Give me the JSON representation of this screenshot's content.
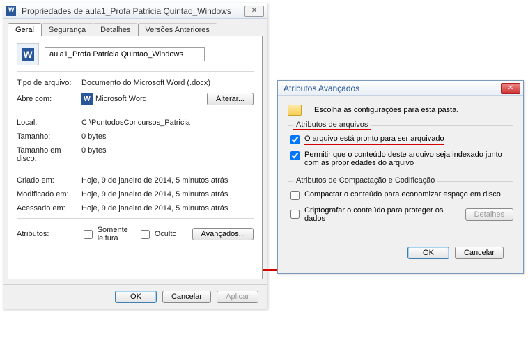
{
  "props_window": {
    "title": "Propriedades de aula1_Profa Patrícia Quintao_Windows",
    "close_glyph": "✕",
    "tabs": {
      "geral": "Geral",
      "seguranca": "Segurança",
      "detalhes": "Detalhes",
      "versoes": "Versões Anteriores"
    },
    "file_name": "aula1_Profa Patrícia Quintao_Windows",
    "labels": {
      "tipo": "Tipo de arquivo:",
      "abre": "Abre com:",
      "local": "Local:",
      "tamanho": "Tamanho:",
      "tamanho_disco": "Tamanho em disco:",
      "criado": "Criado em:",
      "modificado": "Modificado em:",
      "acessado": "Acessado em:",
      "atributos": "Atributos:"
    },
    "values": {
      "tipo": "Documento do Microsoft Word (.docx)",
      "abre": "Microsoft Word",
      "local": "C:\\PontodosConcursos_Patricia",
      "tamanho": "0 bytes",
      "tamanho_disco": "0 bytes",
      "criado": "Hoje, 9 de janeiro de 2014, 5 minutos atrás",
      "modificado": "Hoje, 9 de janeiro de 2014, 5 minutos atrás",
      "acessado": "Hoje, 9 de janeiro de 2014, 5 minutos atrás"
    },
    "buttons": {
      "alterar": "Alterar...",
      "avancados": "Avançados...",
      "ok": "OK",
      "cancelar": "Cancelar",
      "aplicar": "Aplicar"
    },
    "check_labels": {
      "somente_leitura": "Somente leitura",
      "oculto": "Oculto"
    }
  },
  "adv_window": {
    "title": "Atributos Avançados",
    "close_glyph": "✕",
    "intro": "Escolha as configurações para esta pasta.",
    "groups": {
      "arquivos_legend": "Atributos de arquivos",
      "comp_legend": "Atributos de Compactação e Codificação"
    },
    "check_labels": {
      "arquivar": "O arquivo está pronto para ser arquivado",
      "indexar": "Permitir que o conteúdo deste arquivo seja indexado junto com as propriedades do arquivo",
      "compactar": "Compactar o conteúdo para economizar espaço em disco",
      "criptografar": "Criptografar o conteúdo para proteger os dados"
    },
    "checks": {
      "arquivar": true,
      "indexar": true,
      "compactar": false,
      "criptografar": false
    },
    "buttons": {
      "detalhes": "Detalhes",
      "ok": "OK",
      "cancelar": "Cancelar"
    }
  }
}
